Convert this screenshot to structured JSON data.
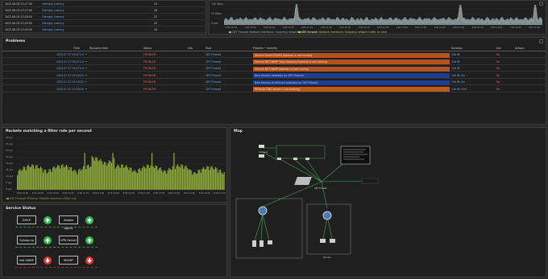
{
  "top_left": {
    "rows": [
      {
        "time": "2022-06-05 22:27:30",
        "label": "Gateway Latency",
        "value": "24"
      },
      {
        "time": "2022-06-05 22:27:00",
        "label": "Gateway Latency",
        "value": "18"
      },
      {
        "time": "2022-06-05 22:26:00",
        "label": "Gateway Latency",
        "value": "27"
      },
      {
        "time": "2022-06-05 22:25:30",
        "label": "Gateway Latency",
        "value": "22"
      },
      {
        "time": "2022-06-05 22:25:00",
        "label": "Gateway Latency",
        "value": "19"
      }
    ]
  },
  "traffic": {
    "y_ticks": [
      "100 Kbps",
      "50 Kbps",
      "0 bps"
    ],
    "x_ticks": [
      "8:00 10:00",
      "8:00 10:20",
      "8:00 10:40",
      "8:00 11:00",
      "8:00 11:20",
      "8:00 11:40",
      "8:00 12:00",
      "8:00 12:20",
      "8:00 12:40",
      "8:00 13:00",
      "8:00 13:20",
      "8:00 13:40",
      "8:00 14:00",
      "8:00 14:20",
      "8:00 14:40",
      "8:00 15:00",
      "8:00 15:20"
    ],
    "legend": [
      "CBT Firewall: Network interfaces: Incoming network traffic on em0",
      "CBT Firewall: Network interfaces: Outgoing network traffic on em0"
    ],
    "colors": {
      "incoming": "#9fb0bd",
      "outgoing": "#b7ce5a"
    }
  },
  "problems": {
    "title": "Problems",
    "columns": {
      "time": "Time",
      "recovery": "Recovery time",
      "status": "Status",
      "info": "Info",
      "host": "Host",
      "problem": "Problem • Severity",
      "duration": "Duration",
      "ack": "Ack",
      "actions": "Actions"
    },
    "rows": [
      {
        "time": "2022-07-27 09:27:10",
        "status": "PROBLEM",
        "host": "CBT Firewall",
        "problem": "Service Snort IDS/IPS Daemon is not running",
        "duration": "10d 8h",
        "ack": "No",
        "severity": "high"
      },
      {
        "time": "2022-07-27 09:27:10",
        "status": "PROBLEM",
        "host": "CBT Firewall",
        "problem": "Service NET-SNMP Trap Listening Daemon is not running",
        "duration": "10d 8h",
        "ack": "No",
        "severity": "high"
      },
      {
        "time": "2022-07-27 09:27:10",
        "status": "PROBLEM",
        "host": "CBT Firewall",
        "problem": "Service NET-SNMP Daemon is not running",
        "duration": "10d 8h",
        "ack": "No",
        "severity": "high"
      },
      {
        "time": "2022-07-27 09:18:22",
        "status": "PROBLEM",
        "host": "CBT Firewall",
        "problem": "New Version Available on CBT Firewall",
        "duration": "10d 8h 2m",
        "ack": "No",
        "severity": "info"
      },
      {
        "time": "2022-07-27 09:18:22",
        "status": "PROBLEM",
        "host": "CBT Firewall",
        "problem": "New Version of pfSense Available on CBT Firewall",
        "duration": "10d 8h 2m",
        "ack": "No",
        "severity": "info"
      },
      {
        "time": "2022-07-27 13:16:30",
        "status": "PROBLEM",
        "host": "CBT Firewall",
        "problem": "PFSense DNS server is not working",
        "duration": "10d 8h 59m",
        "ack": "No",
        "severity": "average"
      }
    ],
    "colors": {
      "high": "#b4531f",
      "info": "#1e3d8f",
      "average": "#c05a1b"
    }
  },
  "packets": {
    "title": "Packets matching a filter rule per second",
    "y_ticks": [
      "40 pps",
      "35 pps",
      "30 pps",
      "25 pps",
      "20 pps",
      "15 pps",
      "10 pps",
      "5 pps",
      "0 pps"
    ],
    "x_ticks": [
      "8:00 10:00",
      "8:00 10:20",
      "8:00 10:40",
      "8:00 11:00",
      "8:00 11:20",
      "8:00 11:40",
      "8:00 12:00",
      "8:00 12:20",
      "8:00 12:40",
      "8:00 13:00",
      "8:00 13:20",
      "8:00 13:40",
      "8:00 14:00",
      "8:00 14:20"
    ],
    "legend": "CBT Firewall: PFSense: Packets matched a filter rule",
    "bar_color": "#8aa53a"
  },
  "service_status": {
    "title": "Service Status",
    "items": [
      {
        "label": "DHCP",
        "status": "up"
      },
      {
        "label": "Zabbix Agent",
        "status": "up"
      },
      {
        "label": "Syslog-ng",
        "status": "up"
      },
      {
        "label": "VPN Server",
        "status": "up"
      },
      {
        "label": "Net SNMP",
        "status": "down"
      },
      {
        "label": "SNORT",
        "status": "down"
      }
    ]
  },
  "map": {
    "title": "Map",
    "labels": {
      "gateway": "Gateway",
      "firewall": "CBT Firewall",
      "servers_left": "Servers",
      "servers_right": "Servers",
      "switch": "Switch",
      "info_box": "CBT Firewall info"
    }
  }
}
